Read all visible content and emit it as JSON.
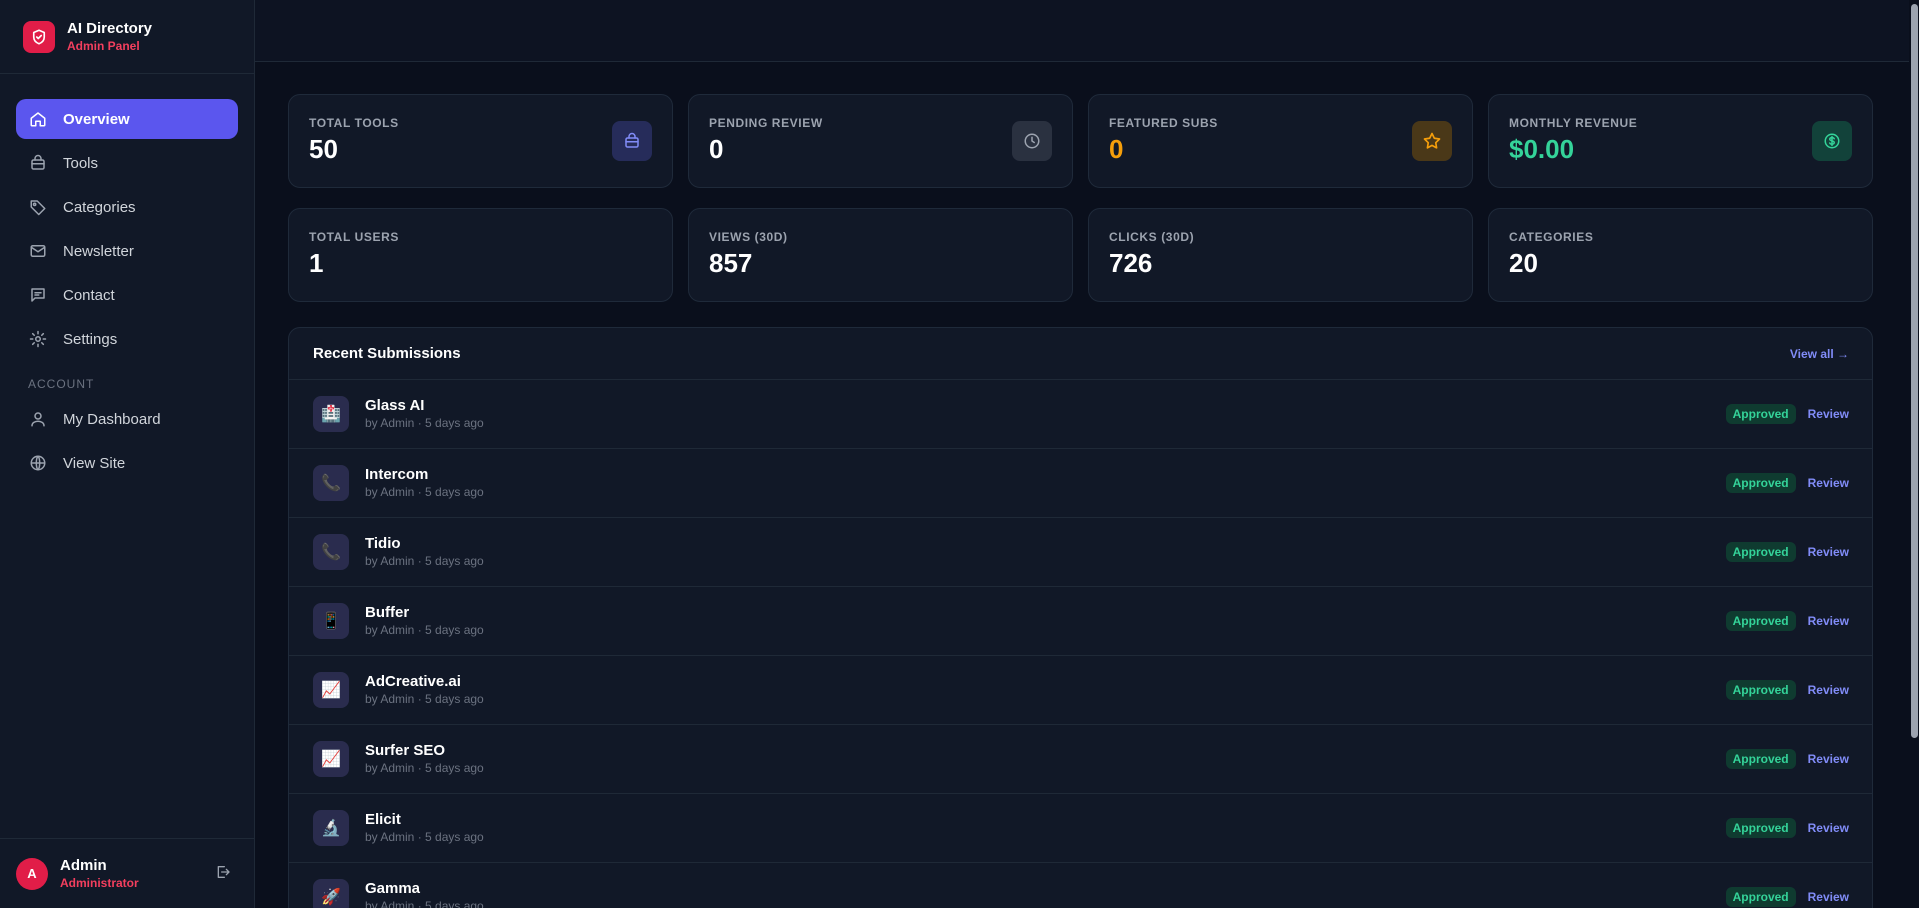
{
  "brand": {
    "title": "AI Directory",
    "subtitle": "Admin Panel"
  },
  "nav": {
    "items": [
      {
        "label": "Overview",
        "icon": "home-icon",
        "active": true
      },
      {
        "label": "Tools",
        "icon": "box-icon"
      },
      {
        "label": "Categories",
        "icon": "tag-icon"
      },
      {
        "label": "Newsletter",
        "icon": "mail-icon"
      },
      {
        "label": "Contact",
        "icon": "chat-icon"
      },
      {
        "label": "Settings",
        "icon": "gear-icon"
      }
    ],
    "account_section": "ACCOUNT",
    "account_items": [
      {
        "label": "My Dashboard",
        "icon": "user-icon"
      },
      {
        "label": "View Site",
        "icon": "globe-icon"
      }
    ]
  },
  "user": {
    "initial": "A",
    "name": "Admin",
    "role": "Administrator"
  },
  "stats": [
    {
      "label": "TOTAL TOOLS",
      "value": "50",
      "icon": "box-icon"
    },
    {
      "label": "PENDING REVIEW",
      "value": "0",
      "icon": "clock-icon"
    },
    {
      "label": "FEATURED SUBS",
      "value": "0",
      "icon": "star-icon"
    },
    {
      "label": "MONTHLY REVENUE",
      "value": "$0.00",
      "icon": "dollar-icon"
    },
    {
      "label": "TOTAL USERS",
      "value": "1"
    },
    {
      "label": "VIEWS (30D)",
      "value": "857"
    },
    {
      "label": "CLICKS (30D)",
      "value": "726"
    },
    {
      "label": "CATEGORIES",
      "value": "20"
    }
  ],
  "submissions": {
    "title": "Recent Submissions",
    "view_all": "View all →",
    "items": [
      {
        "name": "Glass AI",
        "meta": "by Admin · 5 days ago",
        "icon": "🏥",
        "status": "Approved",
        "action": "Review"
      },
      {
        "name": "Intercom",
        "meta": "by Admin · 5 days ago",
        "icon": "📞",
        "status": "Approved",
        "action": "Review"
      },
      {
        "name": "Tidio",
        "meta": "by Admin · 5 days ago",
        "icon": "📞",
        "status": "Approved",
        "action": "Review"
      },
      {
        "name": "Buffer",
        "meta": "by Admin · 5 days ago",
        "icon": "📱",
        "status": "Approved",
        "action": "Review"
      },
      {
        "name": "AdCreative.ai",
        "meta": "by Admin · 5 days ago",
        "icon": "📈",
        "status": "Approved",
        "action": "Review"
      },
      {
        "name": "Surfer SEO",
        "meta": "by Admin · 5 days ago",
        "icon": "📈",
        "status": "Approved",
        "action": "Review"
      },
      {
        "name": "Elicit",
        "meta": "by Admin · 5 days ago",
        "icon": "🔬",
        "status": "Approved",
        "action": "Review"
      },
      {
        "name": "Gamma",
        "meta": "by Admin · 5 days ago",
        "icon": "🚀",
        "status": "Approved",
        "action": "Review"
      }
    ]
  },
  "colors": {
    "accent": "#5b56ee",
    "brand": "#e11d48",
    "success": "#34d399",
    "gold": "#f59e0b"
  }
}
